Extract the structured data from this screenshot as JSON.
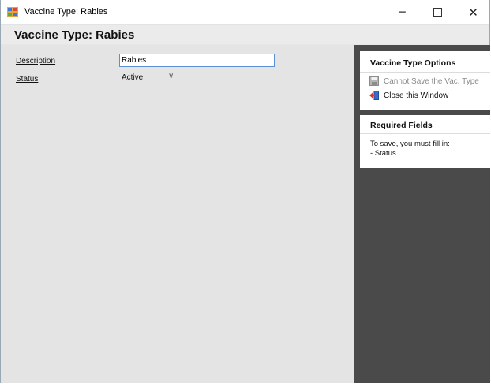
{
  "window": {
    "title": "Vaccine Type: Rabies",
    "minimize_glyph": "─",
    "close_glyph": "✕"
  },
  "header": {
    "title": "Vaccine Type: Rabies"
  },
  "form": {
    "description_label": "Description",
    "description_value": "Rabies",
    "status_label": "Status",
    "status_value": "Active",
    "status_chevron": "∨"
  },
  "options_panel": {
    "title": "Vaccine Type Options",
    "save_label": "Cannot Save the Vac. Type",
    "close_label": "Close this Window",
    "save_icon": "floppy-disk-icon",
    "close_icon": "exit-door-icon"
  },
  "required_panel": {
    "title": "Required Fields",
    "line1": "To save, you must fill in:",
    "line2": "- Status"
  },
  "colors": {
    "sidebar_bg": "#4a4a4a",
    "form_bg": "#e4e4e4",
    "input_focus_border": "#5c8fd6",
    "disabled_text": "#8a8a8a"
  }
}
